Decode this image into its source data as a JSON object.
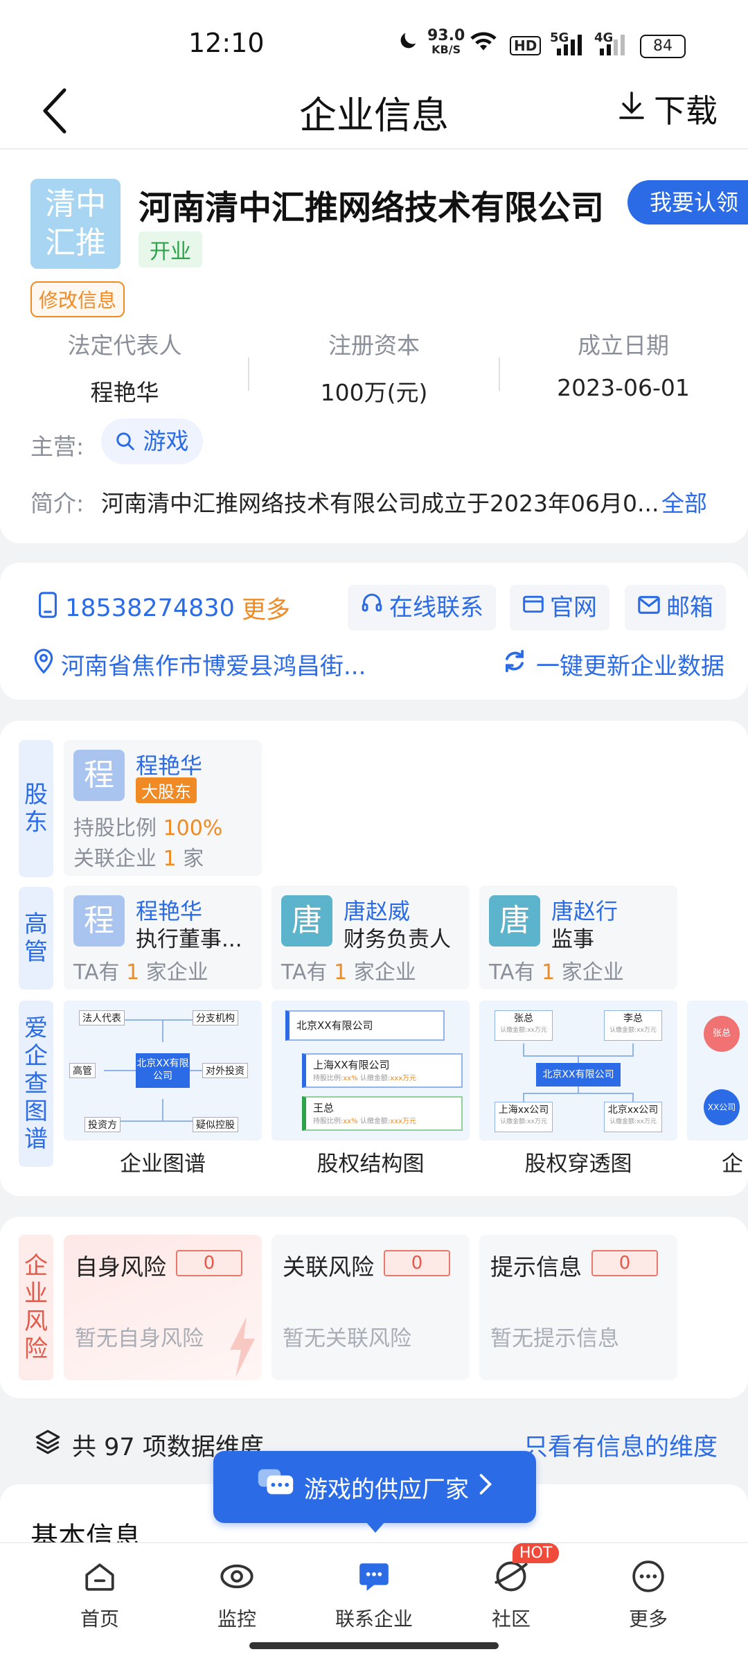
{
  "status_bar": {
    "time": "12:10",
    "net_speed_value": "93.0",
    "net_speed_unit": "KB/S",
    "hd_label": "HD",
    "signal_5g": "5G",
    "signal_4g": "4G",
    "battery": "84"
  },
  "nav": {
    "title": "企业信息",
    "download_label": "下载"
  },
  "company": {
    "logo_line1": "清中",
    "logo_line2": "汇推",
    "name": "河南清中汇推网络技术有限公司",
    "status": "开业",
    "claim_label": "我要认领",
    "modify_label": "修改信息",
    "stats": [
      {
        "label": "法定代表人",
        "value": "程艳华"
      },
      {
        "label": "注册资本",
        "value": "100万(元)"
      },
      {
        "label": "成立日期",
        "value": "2023-06-01"
      }
    ],
    "business_label": "主营:",
    "business_tag": "游戏",
    "intro_label": "简介:",
    "intro_text": "河南清中汇推网络技术有限公司成立于2023年06月0...",
    "intro_all": "全部"
  },
  "contact": {
    "phone": "18538274830",
    "more": "更多",
    "online": "在线联系",
    "website": "官网",
    "email": "邮箱",
    "address": "河南省焦作市博爱县鸿昌街...",
    "refresh": "一键更新企业数据"
  },
  "shareholders": {
    "label": "股东",
    "items": [
      {
        "avatar": "程",
        "name": "程艳华",
        "badge": "大股东",
        "ratio_label": "持股比例",
        "ratio": "100%",
        "related_label": "关联企业",
        "related_count": "1",
        "related_unit": "家"
      }
    ]
  },
  "executives": {
    "label": "高管",
    "items": [
      {
        "avatar": "程",
        "name": "程艳华",
        "role": "执行董事...",
        "prefix": "TA有",
        "count": "1",
        "suffix": "家企业",
        "color": "#a9c4ee"
      },
      {
        "avatar": "唐",
        "name": "唐赵威",
        "role": "财务负责人",
        "prefix": "TA有",
        "count": "1",
        "suffix": "家企业",
        "color": "#5bb4cc"
      },
      {
        "avatar": "唐",
        "name": "唐赵行",
        "role": "监事",
        "prefix": "TA有",
        "count": "1",
        "suffix": "家企业",
        "color": "#5bb4cc"
      }
    ]
  },
  "graphs": {
    "label": "爱企查图谱",
    "items": [
      {
        "caption": "企业图谱",
        "center": "北京XX有限公司",
        "nodes": [
          "法人代表",
          "分支机构",
          "高管",
          "对外投资",
          "投资方",
          "疑似控股"
        ]
      },
      {
        "caption": "股权结构图",
        "top": "北京XX有限公司",
        "mid": "上海XX有限公司",
        "bottom": "王总",
        "meta_ratio": "持股比例:",
        "meta_ratio_val": "xx%",
        "meta_amt": "认缴金额:",
        "meta_amt_val": "xxx万元"
      },
      {
        "caption": "股权穿透图",
        "tl": "张总",
        "tr": "李总",
        "tl_sub": "认缴金额:xx万元",
        "tr_sub": "认缴金额:xx万元",
        "center": "北京XX有限公司",
        "bl": "上海xx公司",
        "br": "北京xx公司",
        "bl_sub": "认缴金额:xx万元",
        "br_sub": "认缴金额:xx万元"
      },
      {
        "caption": "企",
        "n1": "张总",
        "n2": "XX公司"
      }
    ]
  },
  "risk": {
    "label": "企业风险",
    "items": [
      {
        "title": "自身风险",
        "count": "0",
        "desc": "暂无自身风险"
      },
      {
        "title": "关联风险",
        "count": "0",
        "desc": "暂无关联风险"
      },
      {
        "title": "提示信息",
        "count": "0",
        "desc": "暂无提示信息"
      }
    ]
  },
  "dimensions": {
    "prefix": "共",
    "count": "97",
    "suffix": "项数据维度",
    "only_info": "只看有信息的维度"
  },
  "promo": {
    "label": "游戏的供应厂家"
  },
  "basic_info": {
    "title": "基本信息"
  },
  "tabbar": {
    "items": [
      {
        "label": "首页",
        "icon": "home-icon"
      },
      {
        "label": "监控",
        "icon": "eye-icon"
      },
      {
        "label": "联系企业",
        "icon": "chat-icon"
      },
      {
        "label": "社区",
        "icon": "community-icon"
      },
      {
        "label": "更多",
        "icon": "more-icon"
      }
    ],
    "hot_badge": "HOT"
  }
}
